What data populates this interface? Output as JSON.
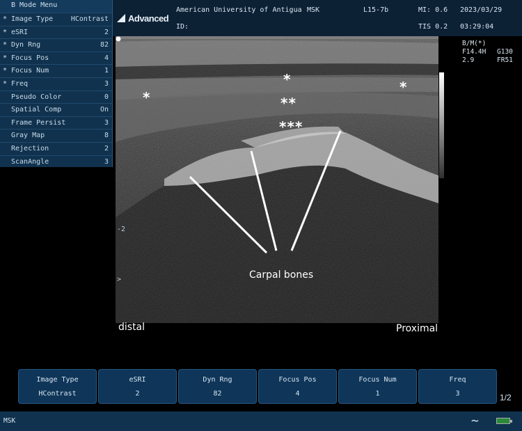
{
  "header": {
    "institution": "American University of Antigua",
    "exam_type": "MSK",
    "probe": "L15-7b",
    "mi": "MI: 0.6",
    "date": "2023/03/29",
    "id_label": "ID:",
    "tis": "TIS 0.2",
    "time": "03:29:04",
    "logo_text": "Advanced"
  },
  "menu": {
    "title": "B Mode Menu",
    "items": [
      {
        "star": "*",
        "label": "Image Type",
        "value": "HContrast"
      },
      {
        "star": "*",
        "label": "eSRI",
        "value": "2"
      },
      {
        "star": "*",
        "label": "Dyn Rng",
        "value": "82"
      },
      {
        "star": "*",
        "label": "Focus Pos",
        "value": "4"
      },
      {
        "star": "*",
        "label": "Focus Num",
        "value": "1"
      },
      {
        "star": "*",
        "label": "Freq",
        "value": "3"
      },
      {
        "star": "",
        "label": "Pseudo Color",
        "value": "0"
      },
      {
        "star": "",
        "label": "Spatial Comp",
        "value": "On"
      },
      {
        "star": "",
        "label": "Frame Persist",
        "value": "3"
      },
      {
        "star": "",
        "label": "Gray Map",
        "value": "8"
      },
      {
        "star": "",
        "label": "Rejection",
        "value": "2"
      },
      {
        "star": "",
        "label": "ScanAngle",
        "value": "3"
      }
    ]
  },
  "side_info": {
    "mode": "B/M(*)",
    "freq": "F14.4H",
    "gain": "G130",
    "depth": "2.9",
    "frame_rate": "FR51"
  },
  "depth_scale": {
    "mark_2": "2",
    "focus_marker": ">"
  },
  "annotations": {
    "star_1": "*",
    "star_2": "*",
    "star_3": "*",
    "star_double": "**",
    "star_triple": "***",
    "carpal_label": "Carpal bones",
    "distal_label": "distal",
    "proximal_label": "Proximal"
  },
  "soft_keys": [
    {
      "label": "Image Type",
      "value": "HContrast"
    },
    {
      "label": "eSRI",
      "value": "2"
    },
    {
      "label": "Dyn Rng",
      "value": "82"
    },
    {
      "label": "Focus Pos",
      "value": "4"
    },
    {
      "label": "Focus Num",
      "value": "1"
    },
    {
      "label": "Freq",
      "value": "3"
    }
  ],
  "page_indicator": "1/2",
  "status": {
    "mode_text": "MSK",
    "icons": [
      "wave-icon",
      "battery-icon"
    ]
  },
  "colors": {
    "panel": "#11324e",
    "header": "#0d2135",
    "key": "#0f3558",
    "annotation": "#ffffff"
  }
}
